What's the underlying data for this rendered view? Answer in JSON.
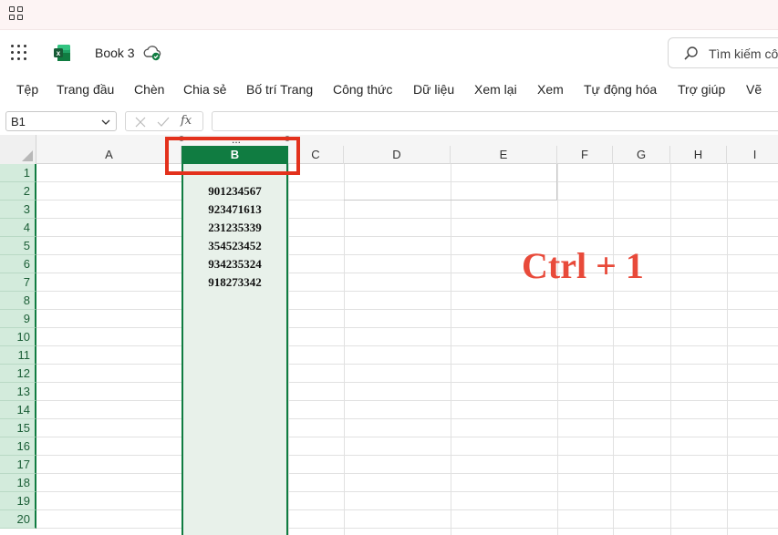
{
  "app": {
    "doc_title": "Book 3",
    "search_placeholder": "Tìm kiếm cô"
  },
  "ribbon": {
    "tabs": [
      "Tệp",
      "Trang đầu",
      "Chèn",
      "Chia sẻ",
      "Bố trí Trang",
      "Công thức",
      "Dữ liệu",
      "Xem lại",
      "Xem",
      "Tự động hóa",
      "Trợ giúp",
      "Vẽ"
    ]
  },
  "formula_bar": {
    "name_box": "B1",
    "fx_label": "fx",
    "formula": ""
  },
  "sheet": {
    "columns": [
      "A",
      "B",
      "C",
      "D",
      "E",
      "F",
      "G",
      "H",
      "I"
    ],
    "selected_column": "B",
    "rows": [
      "1",
      "2",
      "3",
      "4",
      "5",
      "6",
      "7",
      "8",
      "9",
      "10",
      "11",
      "12",
      "13",
      "14",
      "15",
      "16",
      "17",
      "18",
      "19",
      "20"
    ],
    "column_b_values": [
      "",
      "901234567",
      "923471613",
      "231235339",
      "354523452",
      "934235324",
      "918273342"
    ],
    "drag_dots": "..."
  },
  "annotation": {
    "shortcut": "Ctrl + 1",
    "highlight_color": "#e3311c"
  },
  "colors": {
    "accent": "#107c41",
    "selection_fill": "#e8f1ea"
  }
}
